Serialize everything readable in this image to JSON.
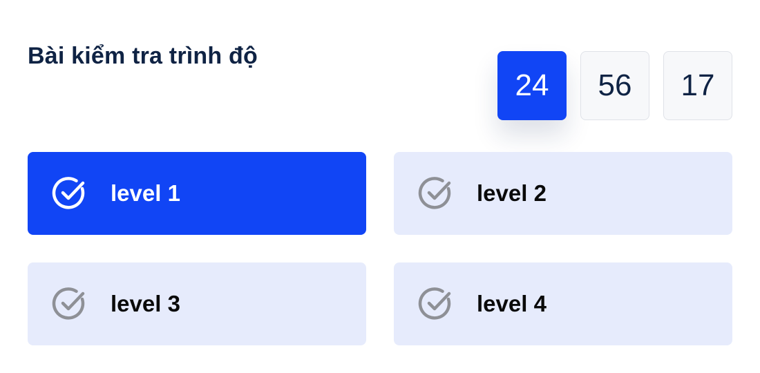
{
  "header": {
    "title": "Bài kiểm tra trình độ"
  },
  "timer": {
    "values": [
      "24",
      "56",
      "17"
    ],
    "active_index": 0
  },
  "levels": [
    {
      "label": "level 1",
      "selected": true
    },
    {
      "label": "level 2",
      "selected": false
    },
    {
      "label": "level 3",
      "selected": false
    },
    {
      "label": "level 4",
      "selected": false
    }
  ],
  "icons": {
    "level_icon": "check-circle-icon"
  },
  "colors": {
    "accent": "#1145f5",
    "title": "#0f2344",
    "option_bg": "#e6ebfc",
    "icon_idle": "#8e9096",
    "timer_idle_bg": "#f7f8fa"
  }
}
